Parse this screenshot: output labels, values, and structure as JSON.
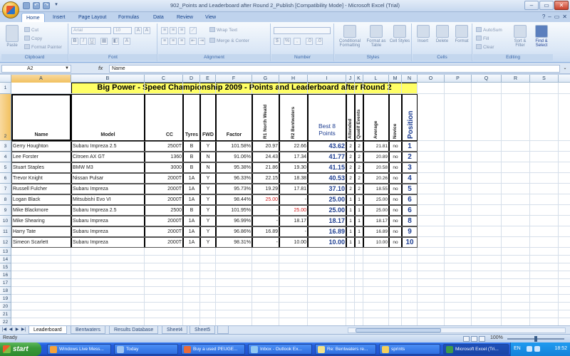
{
  "window": {
    "title": "902_Points and Leaderboard after Round 2_Publish  [Compatibility Mode]  -  Microsoft Excel (Trial)"
  },
  "ribbon": {
    "tabs": [
      "Home",
      "Insert",
      "Page Layout",
      "Formulas",
      "Data",
      "Review",
      "View"
    ],
    "groups": {
      "clipboard": {
        "label": "Clipboard",
        "paste": "Paste",
        "cut": "Cut",
        "copy": "Copy",
        "format_painter": "Format Painter"
      },
      "font": {
        "label": "Font",
        "font_name": "Arial",
        "font_size": "10"
      },
      "alignment": {
        "label": "Alignment",
        "wrap_text": "Wrap Text",
        "merge_center": "Merge & Center"
      },
      "number": {
        "label": "Number"
      },
      "styles": {
        "label": "Styles",
        "conditional": "Conditional Formatting",
        "format_table": "Format as Table",
        "cell_styles": "Cell Styles"
      },
      "cells": {
        "label": "Cells",
        "insert": "Insert",
        "delete": "Delete",
        "format": "Format"
      },
      "editing": {
        "label": "Editing",
        "autosum": "AutoSum",
        "fill": "Fill",
        "clear": "Clear",
        "sort_filter": "Sort & Filter",
        "find_select": "Find & Select"
      }
    }
  },
  "formula_bar": {
    "name_box": "A2",
    "fx": "fx",
    "value": "Name"
  },
  "columns": [
    "A",
    "B",
    "C",
    "D",
    "E",
    "F",
    "G",
    "H",
    "I",
    "J",
    "K",
    "L",
    "M",
    "N",
    "O",
    "P",
    "Q",
    "R",
    "S"
  ],
  "rows": [
    "1",
    "2",
    "3",
    "4",
    "5",
    "6",
    "7",
    "8",
    "9",
    "10",
    "11",
    "12",
    "13",
    "14",
    "15",
    "16",
    "17",
    "18",
    "19",
    "20",
    "21",
    "22"
  ],
  "sheet": {
    "title": "Big Power - Speed Championship 2009 - Points and Leaderboard after Round 2",
    "headers": {
      "name": "Name",
      "model": "Model",
      "cc": "CC",
      "tyres": "Tyres",
      "fwd": "FWD",
      "factor": "Factor",
      "r1": "R1 North Weald",
      "r2": "R2 Bentwaters",
      "best8_line1": "Best 8",
      "best8_line2": "Points",
      "attended": "Attended",
      "qualif": "Qualif Events",
      "average": "Average",
      "novice": "Novice",
      "position": "Position"
    },
    "data": [
      [
        "Gerry Houghton",
        "Subaru Impreza 2.5",
        "2500T",
        "B",
        "Y",
        "101.58%",
        "20.97",
        "22.66",
        "43.62",
        "2",
        "2",
        "21.81",
        "no",
        "1"
      ],
      [
        "Lee Forster",
        "Citroen AX GT",
        "1360",
        "B",
        "N",
        "91.06%",
        "24.43",
        "17.34",
        "41.77",
        "2",
        "2",
        "20.89",
        "no",
        "2"
      ],
      [
        "Stuart Staples",
        "BMW M3",
        "3000",
        "B",
        "N",
        "95.38%",
        "21.86",
        "19.30",
        "41.15",
        "2",
        "2",
        "20.58",
        "no",
        "3"
      ],
      [
        "Trevor Knight",
        "Nissan Pulsar",
        "2000T",
        "1A",
        "Y",
        "96.33%",
        "22.15",
        "18.38",
        "40.53",
        "2",
        "2",
        "20.26",
        "no",
        "4"
      ],
      [
        "Russell Fulcher",
        "Subaru Impreza",
        "2000T",
        "1A",
        "Y",
        "95.73%",
        "19.29",
        "17.81",
        "37.10",
        "2",
        "2",
        "18.55",
        "no",
        "5"
      ],
      [
        "Logan Black",
        "Mitsubishi Evo VI",
        "2000T",
        "1A",
        "Y",
        "98.44%",
        "25.00",
        "-",
        "25.00",
        "1",
        "1",
        "25.00",
        "no",
        "6"
      ],
      [
        "Mike Blackmore",
        "Subaru Impreza 2.5",
        "2500",
        "B",
        "Y",
        "101.95%",
        "-",
        "25.00",
        "25.00",
        "1",
        "1",
        "25.00",
        "no",
        "6"
      ],
      [
        "Mike Shearing",
        "Subaru Impreza",
        "2000T",
        "1A",
        "Y",
        "96.99%",
        "-",
        "18.17",
        "18.17",
        "1",
        "1",
        "18.17",
        "no",
        "8"
      ],
      [
        "Harry Tate",
        "Subaru Impreza",
        "2000T",
        "1A",
        "Y",
        "96.86%",
        "16.89",
        "-",
        "16.89",
        "1",
        "1",
        "16.89",
        "no",
        "9"
      ],
      [
        "Simeon Scarlett",
        "Subaru Impreza",
        "2000T",
        "1A",
        "Y",
        "98.31%",
        "-",
        "10.00",
        "10.00",
        "1",
        "1",
        "10.00",
        "no",
        "10"
      ]
    ],
    "red_cells": [
      [
        5,
        6
      ],
      [
        6,
        7
      ]
    ]
  },
  "sheet_tabs": [
    "Leaderboard",
    "Bentwaters",
    "Results Database",
    "Sheet4",
    "Sheet5"
  ],
  "active_sheet": "Leaderboard",
  "status": {
    "text": "Ready",
    "zoom": "100%"
  },
  "taskbar": {
    "start": "start",
    "tasks": [
      "Windows Live Mess...",
      "Today",
      "Buy a used PEUGE...",
      "Inbox - Outlook Ex...",
      "Re: Bentwaters re...",
      "sprints",
      "Microsoft Excel (Tri..."
    ],
    "lang": "EN",
    "time": "18:52"
  },
  "colors": {
    "title_band": "#ffff66",
    "accent_blue": "#1f3f92",
    "red_value": "#d21a1a"
  }
}
